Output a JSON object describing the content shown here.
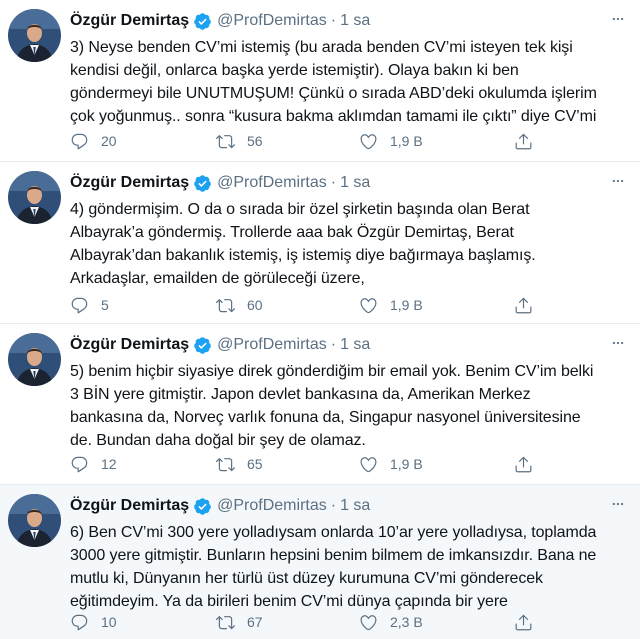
{
  "author": {
    "name": "Özgür Demirtaş",
    "handle": "@ProfDemirtas",
    "verified": true
  },
  "colors": {
    "text": "#0f1419",
    "muted": "#5b7083",
    "verified": "#1da1f2",
    "highlight_bg": "#f5f8fa",
    "divider": "#e6ecf0"
  },
  "tweets": [
    {
      "time": "1 sa",
      "text": "3) Neyse benden CV’mi istemiş (bu arada benden CV’mi isteyen tek kişi\nkendisi değil, onlarca başka yerde istemiştir). Olaya bakın ki ben\ngöndermeyi bile UNUTMUŞUM! Çünkü o sırada ABD’deki okulumda işlerim\nçok yoğunmuş.. sonra “kusura bakma aklımdan tamami ile çıktı” diye CV’mi",
      "replies": "20",
      "retweets": "56",
      "likes": "1,9 B"
    },
    {
      "time": "1 sa",
      "text": "4) göndermişim. O da o sırada bir özel şirketin başında olan Berat\nAlbayrak’a göndermiş. Trollerde aaa bak Özgür Demirtaş, Berat\nAlbayrak’dan bakanlık istemiş, iş istemiş diye bağırmaya başlamış.\nArkadaşlar, emailden de görüleceği üzere,",
      "replies": "5",
      "retweets": "60",
      "likes": "1,9 B"
    },
    {
      "time": "1 sa",
      "text": "5) benim hiçbir siyasiye direk gönderdiğim bir email yok. Benim CV’im belki\n3 BİN yere gitmiştir. Japon devlet bankasına da, Amerikan Merkez\nbankasına da, Norveç varlık fonuna da, Singapur nasyonel üniversitesine\nde. Bundan daha doğal bir şey de olamaz.",
      "replies": "12",
      "retweets": "65",
      "likes": "1,9 B"
    },
    {
      "time": "1 sa",
      "text": "6) Ben CV’mi 300 yere yolladıysam onlarda 10’ar yere yolladıysa, toplamda\n3000 yere gitmiştir. Bunların hepsini benim bilmem de imkansızdır. Bana ne\nmutlu ki, Dünyanın her türlü üst düzey kurumuna CV’mi gönderecek\neğitimdeyim. Ya da birileri benim CV’mi dünya çapında bir yere",
      "replies": "10",
      "retweets": "67",
      "likes": "2,3 B"
    }
  ],
  "icons": {
    "reply": "reply-icon",
    "retweet": "retweet-icon",
    "like": "heart-icon",
    "share": "share-icon",
    "more": "more-icon",
    "verified": "verified-badge-icon"
  }
}
